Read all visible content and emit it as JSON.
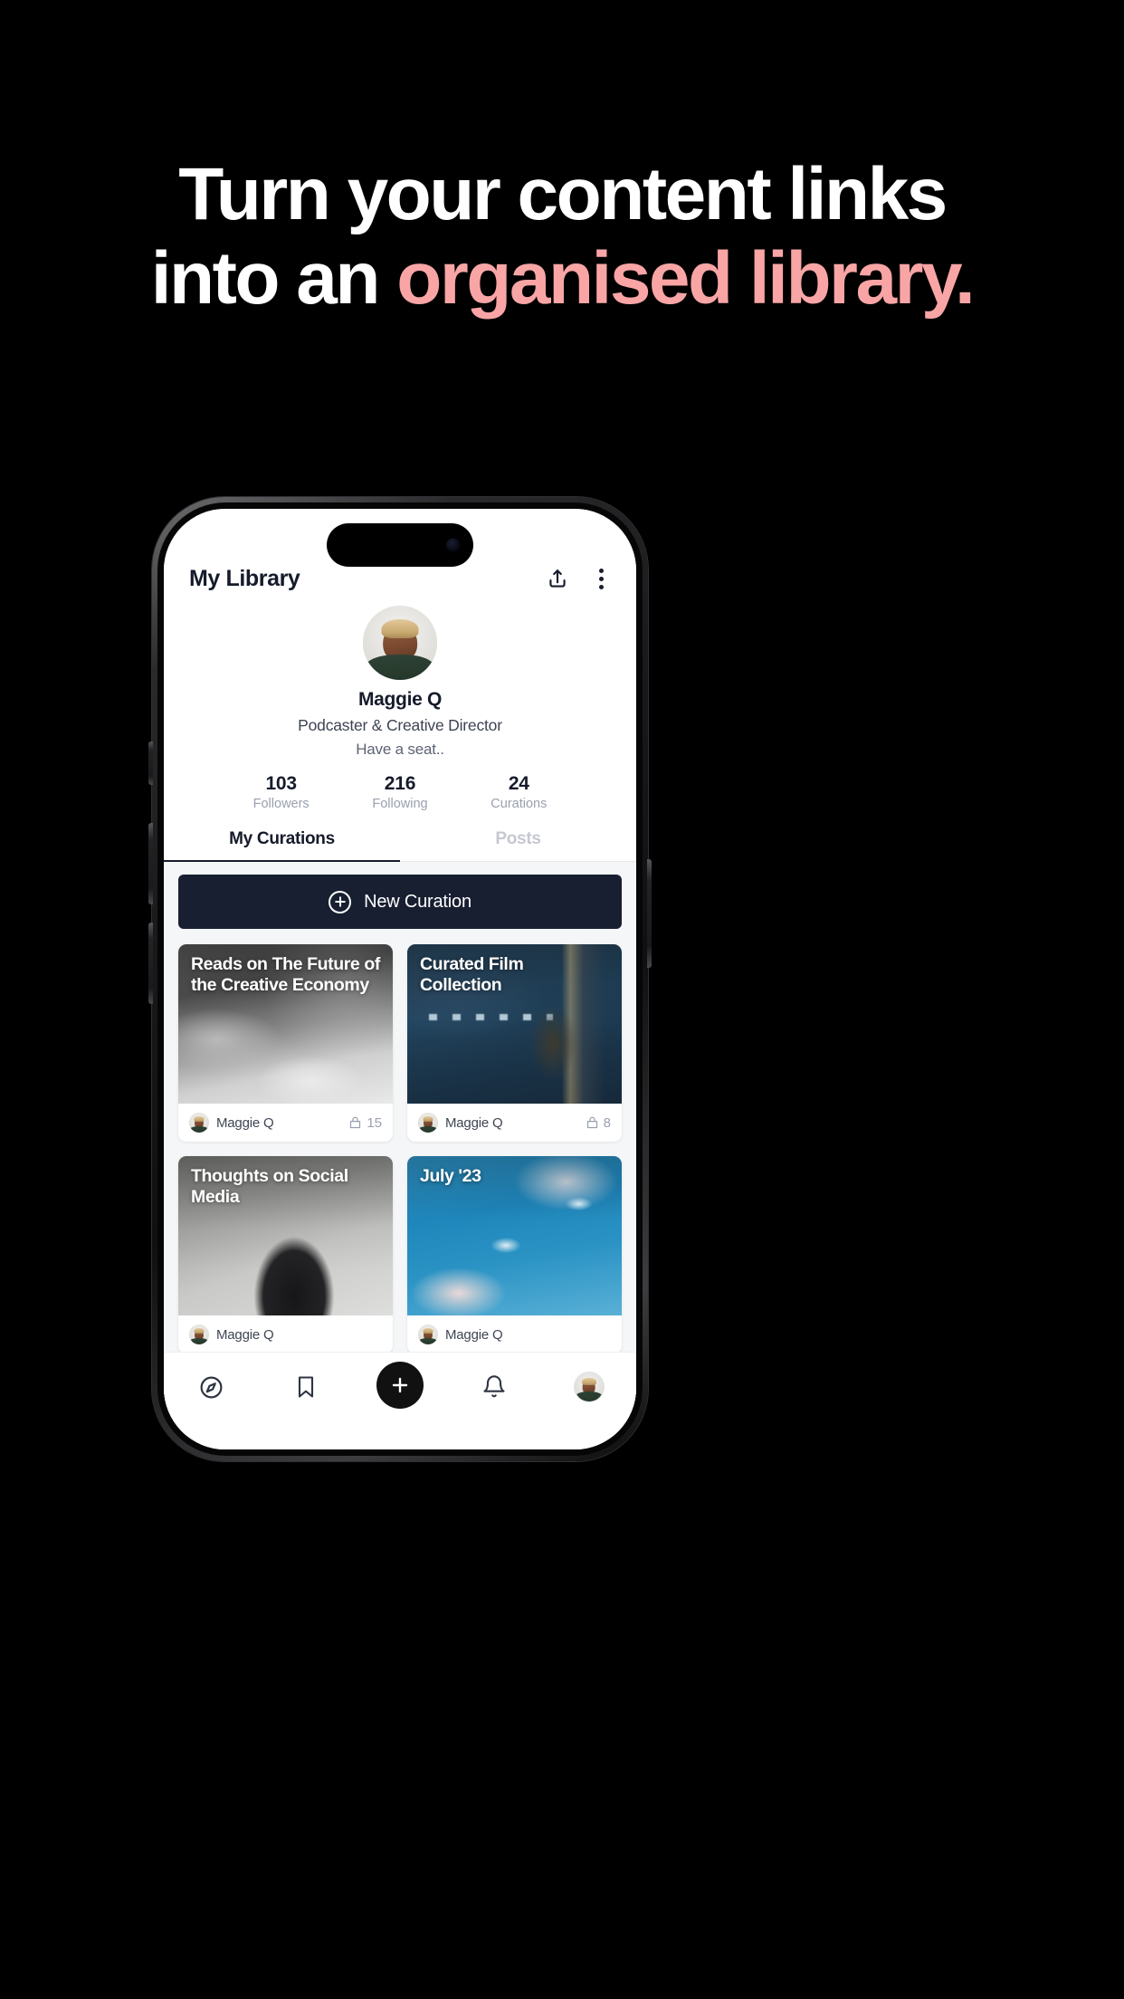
{
  "headline": {
    "line1": "Turn your content links",
    "line2_plain": "into an ",
    "line2_accent": "organised library.",
    "accent_color": "#f9a5a5",
    "text_color": "#ffffff",
    "background_color": "#000000"
  },
  "app": {
    "header": {
      "title": "My Library",
      "share_icon": "share-upload-icon",
      "menu_icon": "kebab-menu-icon"
    },
    "profile": {
      "avatar": "profile-avatar",
      "name": "Maggie Q",
      "role": "Podcaster & Creative Director",
      "bio": "Have a seat..",
      "stats": [
        {
          "value": "103",
          "label": "Followers"
        },
        {
          "value": "216",
          "label": "Following"
        },
        {
          "value": "24",
          "label": "Curations"
        }
      ]
    },
    "tabs": [
      {
        "label": "My Curations",
        "active": true
      },
      {
        "label": "Posts",
        "active": false
      }
    ],
    "new_curation_button": {
      "label": "New Curation",
      "icon": "plus-circle-icon",
      "background_color": "#171f31"
    },
    "cards": [
      {
        "title": "Reads on The Future of the Creative Economy",
        "author": "Maggie Q",
        "count": "15",
        "count_icon": "stack-icon"
      },
      {
        "title": "Curated Film Collection",
        "author": "Maggie Q",
        "count": "8",
        "count_icon": "stack-icon"
      },
      {
        "title": "Thoughts on Social Media",
        "author": "Maggie Q",
        "count": "",
        "count_icon": "stack-icon"
      },
      {
        "title": "July '23",
        "author": "Maggie Q",
        "count": "",
        "count_icon": "stack-icon"
      }
    ],
    "bottom_nav": [
      {
        "icon": "compass-explore-icon",
        "label": ""
      },
      {
        "icon": "bookmark-icon",
        "label": ""
      },
      {
        "icon": "plus-fab-icon",
        "label": ""
      },
      {
        "icon": "bell-notifications-icon",
        "label": ""
      },
      {
        "icon": "profile-avatar-icon",
        "label": ""
      }
    ]
  }
}
